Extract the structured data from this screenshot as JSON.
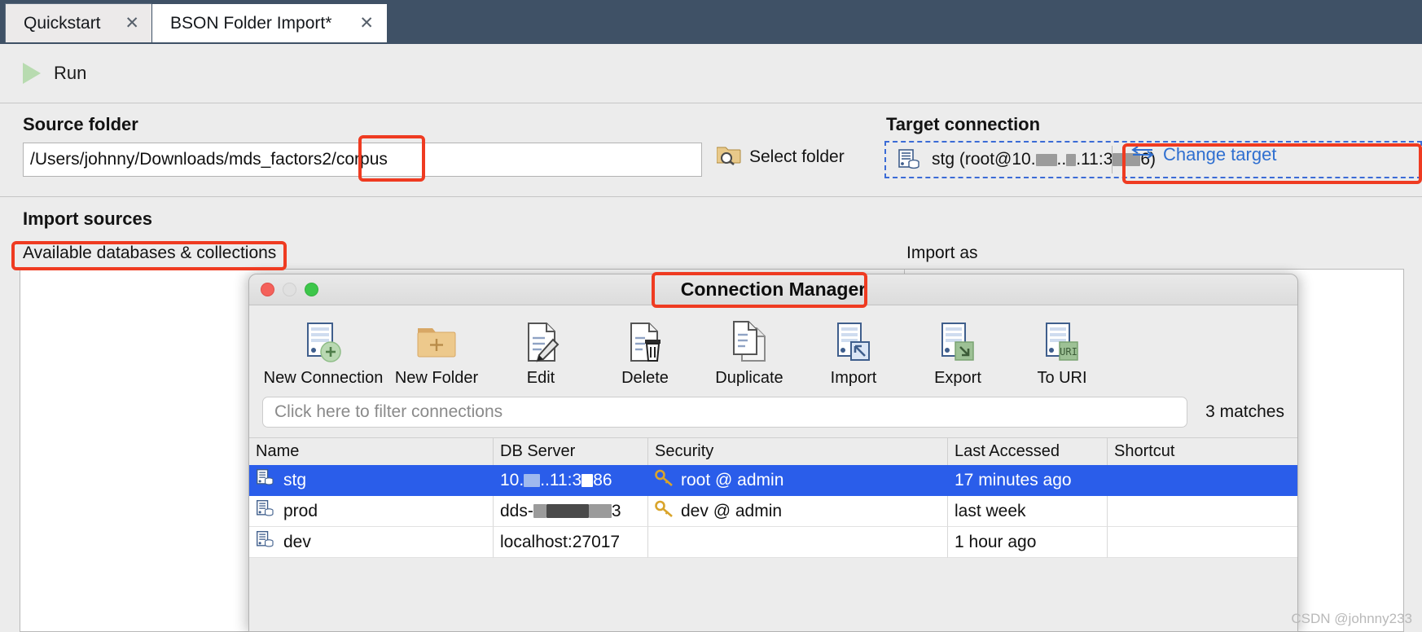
{
  "tabs": [
    {
      "label": "Quickstart",
      "close": "✕",
      "active": false
    },
    {
      "label": "BSON Folder Import*",
      "close": "✕",
      "active": true
    }
  ],
  "toolbar": {
    "run_label": "Run",
    "run_icon": "play-triangle-icon"
  },
  "source": {
    "heading": "Source folder",
    "path_value": "/Users/johnny/Downloads/mds_factors2/corpus",
    "select_folder_label": "Select folder",
    "select_folder_icon": "folder-search-icon"
  },
  "target": {
    "heading": "Target connection",
    "connection_icon": "database-server-icon",
    "connection_prefix": "stg (root@10.",
    "connection_mid": "..",
    "connection_mid2": ".11:3",
    "connection_suffix": "6)",
    "change_label": "Change target",
    "change_icon": "swap-arrows-icon",
    "accent_color": "#2f6fd0",
    "border_color": "#3b6bd6"
  },
  "import_sources": {
    "heading": "Import sources",
    "left_column_header": "Available databases & collections",
    "right_column_header": "Import as"
  },
  "connection_manager": {
    "title": "Connection Manager",
    "window_controls": [
      "close-button",
      "minimize-button",
      "maximize-button"
    ],
    "toolbar": [
      {
        "label": "New Connection",
        "icon": "new-connection-icon"
      },
      {
        "label": "New Folder",
        "icon": "new-folder-icon"
      },
      {
        "label": "Edit",
        "icon": "edit-pencil-icon"
      },
      {
        "label": "Delete",
        "icon": "delete-trash-icon"
      },
      {
        "label": "Duplicate",
        "icon": "duplicate-pages-icon"
      },
      {
        "label": "Import",
        "icon": "import-arrow-icon"
      },
      {
        "label": "Export",
        "icon": "export-arrow-icon"
      },
      {
        "label": "To URI",
        "icon": "to-uri-icon"
      }
    ],
    "filter_placeholder": "Click here to filter connections",
    "matches_label": "3 matches",
    "columns": [
      "Name",
      "DB Server",
      "Security",
      "Last Accessed",
      "Shortcut"
    ],
    "rows": [
      {
        "name": "stg",
        "db_server_prefix": "10.",
        "db_server_mid": "..11:3",
        "db_server_suffix": "86",
        "security": "root @ admin",
        "security_icon": "key-icon",
        "last_accessed": "17 minutes ago",
        "shortcut": "",
        "selected": true
      },
      {
        "name": "prod",
        "db_server_prefix": "dds-",
        "db_server_mid": "",
        "db_server_suffix": "3",
        "security": "dev @ admin",
        "security_icon": "key-icon",
        "last_accessed": "last week",
        "shortcut": "",
        "selected": false
      },
      {
        "name": "dev",
        "db_server_prefix": "localhost:27017",
        "db_server_mid": "",
        "db_server_suffix": "",
        "security": "",
        "security_icon": "",
        "last_accessed": "1 hour ago",
        "shortcut": "",
        "selected": false
      }
    ]
  },
  "annotations": {
    "highlight_color": "#ef3b21",
    "boxes": [
      "source-path-suffix-highlight",
      "change-target-highlight",
      "available-databases-highlight",
      "connection-manager-title-highlight"
    ]
  },
  "watermark": "CSDN @johnny233"
}
